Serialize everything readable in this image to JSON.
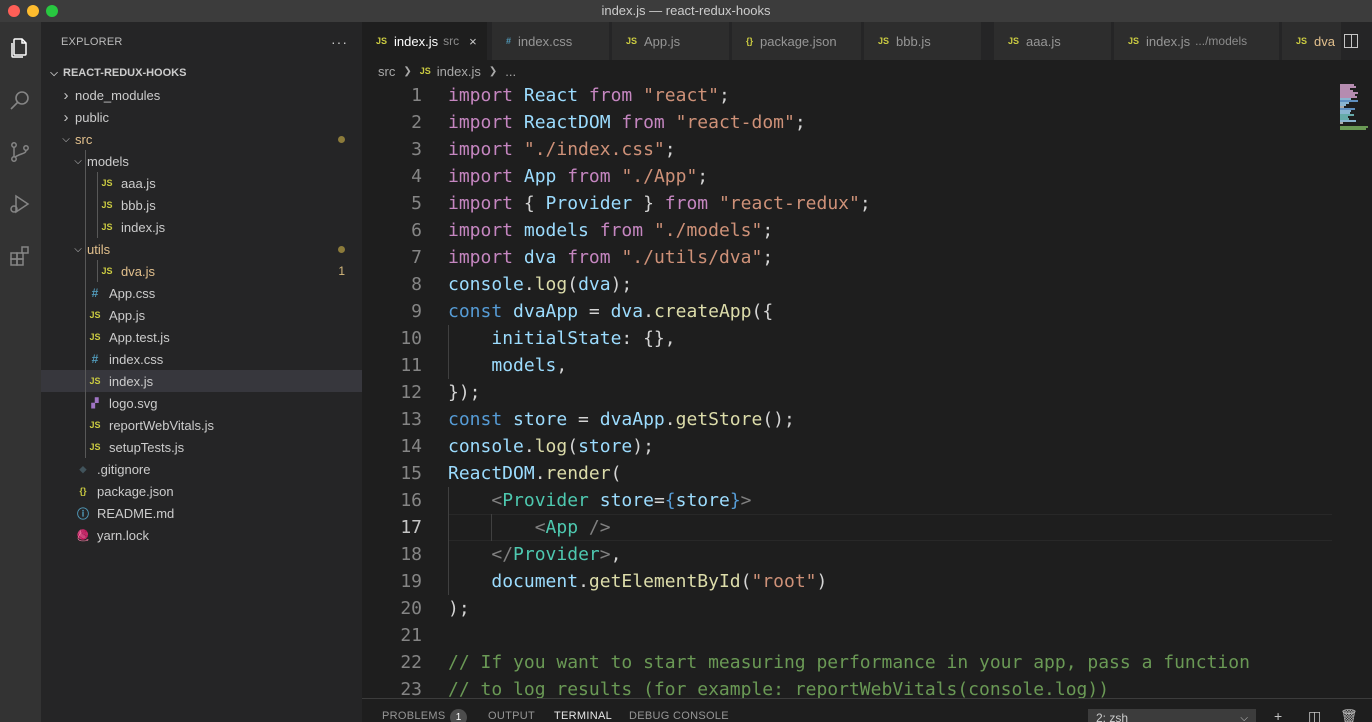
{
  "window": {
    "title": "index.js — react-redux-hooks"
  },
  "activity_bar": [
    "explorer-icon",
    "search-icon",
    "source-control-icon",
    "run-debug-icon",
    "extensions-icon"
  ],
  "sidebar": {
    "title": "EXPLORER",
    "more": "···",
    "root": "REACT-REDUX-HOOKS",
    "items": [
      {
        "label": "node_modules",
        "type": "folder",
        "open": false
      },
      {
        "label": "public",
        "type": "folder",
        "open": false
      },
      {
        "label": "src",
        "type": "folder",
        "open": true
      },
      {
        "label": "models",
        "type": "folder",
        "open": true
      },
      {
        "label": "aaa.js",
        "type": "js",
        "icon_text": "JS"
      },
      {
        "label": "bbb.js",
        "type": "js",
        "icon_text": "JS"
      },
      {
        "label": "index.js",
        "type": "js",
        "icon_text": "JS"
      },
      {
        "label": "utils",
        "type": "folder",
        "open": true
      },
      {
        "label": "dva.js",
        "type": "js",
        "icon_text": "JS",
        "count": "1"
      },
      {
        "label": "App.css",
        "type": "css",
        "icon_text": "#"
      },
      {
        "label": "App.js",
        "type": "js",
        "icon_text": "JS"
      },
      {
        "label": "App.test.js",
        "type": "js",
        "icon_text": "JS"
      },
      {
        "label": "index.css",
        "type": "css",
        "icon_text": "#"
      },
      {
        "label": "index.js",
        "type": "js",
        "icon_text": "JS",
        "selected": true
      },
      {
        "label": "logo.svg",
        "type": "svg"
      },
      {
        "label": "reportWebVitals.js",
        "type": "js",
        "icon_text": "JS"
      },
      {
        "label": "setupTests.js",
        "type": "js",
        "icon_text": "JS"
      },
      {
        "label": ".gitignore",
        "type": "git"
      },
      {
        "label": "package.json",
        "type": "json",
        "icon_text": "{}"
      },
      {
        "label": "README.md",
        "type": "md"
      },
      {
        "label": "yarn.lock",
        "type": "yarn"
      }
    ]
  },
  "tabs": [
    {
      "icon": "JS",
      "label": "index.js",
      "desc": "src",
      "active": true,
      "close": "×"
    },
    {
      "icon": "#",
      "label": "index.css"
    },
    {
      "icon": "JS",
      "label": "App.js"
    },
    {
      "icon": "{}",
      "label": "package.json"
    },
    {
      "icon": "JS",
      "label": "bbb.js"
    },
    {
      "icon": "JS",
      "label": "aaa.js"
    },
    {
      "icon": "JS",
      "label": "index.js",
      "desc": ".../models"
    },
    {
      "icon": "JS",
      "label": "dva"
    }
  ],
  "breadcrumb": {
    "folder": "src",
    "file_icon": "JS",
    "file": "index.js",
    "more": "..."
  },
  "editor": {
    "current_line": 17,
    "lines": [
      [
        [
          "kw",
          "import"
        ],
        [
          "pl",
          " "
        ],
        [
          "var",
          "React"
        ],
        [
          "pl",
          " "
        ],
        [
          "kw",
          "from"
        ],
        [
          "pl",
          " "
        ],
        [
          "str",
          "\"react\""
        ],
        [
          "pl",
          ";"
        ]
      ],
      [
        [
          "kw",
          "import"
        ],
        [
          "pl",
          " "
        ],
        [
          "var",
          "ReactDOM"
        ],
        [
          "pl",
          " "
        ],
        [
          "kw",
          "from"
        ],
        [
          "pl",
          " "
        ],
        [
          "str",
          "\"react-dom\""
        ],
        [
          "pl",
          ";"
        ]
      ],
      [
        [
          "kw",
          "import"
        ],
        [
          "pl",
          " "
        ],
        [
          "str",
          "\"./index.css\""
        ],
        [
          "pl",
          ";"
        ]
      ],
      [
        [
          "kw",
          "import"
        ],
        [
          "pl",
          " "
        ],
        [
          "var",
          "App"
        ],
        [
          "pl",
          " "
        ],
        [
          "kw",
          "from"
        ],
        [
          "pl",
          " "
        ],
        [
          "str",
          "\"./App\""
        ],
        [
          "pl",
          ";"
        ]
      ],
      [
        [
          "kw",
          "import"
        ],
        [
          "pl",
          " { "
        ],
        [
          "var",
          "Provider"
        ],
        [
          "pl",
          " } "
        ],
        [
          "kw",
          "from"
        ],
        [
          "pl",
          " "
        ],
        [
          "str",
          "\"react-redux\""
        ],
        [
          "pl",
          ";"
        ]
      ],
      [
        [
          "kw",
          "import"
        ],
        [
          "pl",
          " "
        ],
        [
          "var",
          "models"
        ],
        [
          "pl",
          " "
        ],
        [
          "kw",
          "from"
        ],
        [
          "pl",
          " "
        ],
        [
          "str",
          "\"./models\""
        ],
        [
          "pl",
          ";"
        ]
      ],
      [
        [
          "kw",
          "import"
        ],
        [
          "pl",
          " "
        ],
        [
          "var",
          "dva"
        ],
        [
          "pl",
          " "
        ],
        [
          "kw",
          "from"
        ],
        [
          "pl",
          " "
        ],
        [
          "str",
          "\"./utils/dva\""
        ],
        [
          "pl",
          ";"
        ]
      ],
      [
        [
          "var",
          "console"
        ],
        [
          "pl",
          "."
        ],
        [
          "fn",
          "log"
        ],
        [
          "pl",
          "("
        ],
        [
          "var",
          "dva"
        ],
        [
          "pl",
          ");"
        ]
      ],
      [
        [
          "kw2",
          "const"
        ],
        [
          "pl",
          " "
        ],
        [
          "var",
          "dvaApp"
        ],
        [
          "pl",
          " = "
        ],
        [
          "var",
          "dva"
        ],
        [
          "pl",
          "."
        ],
        [
          "fn",
          "createApp"
        ],
        [
          "pl",
          "({"
        ]
      ],
      [
        [
          "pl",
          "    "
        ],
        [
          "var",
          "initialState"
        ],
        [
          "pl",
          ": {},"
        ]
      ],
      [
        [
          "pl",
          "    "
        ],
        [
          "var",
          "models"
        ],
        [
          "pl",
          ","
        ]
      ],
      [
        [
          "pl",
          "});"
        ]
      ],
      [
        [
          "kw2",
          "const"
        ],
        [
          "pl",
          " "
        ],
        [
          "var",
          "store"
        ],
        [
          "pl",
          " = "
        ],
        [
          "var",
          "dvaApp"
        ],
        [
          "pl",
          "."
        ],
        [
          "fn",
          "getStore"
        ],
        [
          "pl",
          "();"
        ]
      ],
      [
        [
          "var",
          "console"
        ],
        [
          "pl",
          "."
        ],
        [
          "fn",
          "log"
        ],
        [
          "pl",
          "("
        ],
        [
          "var",
          "store"
        ],
        [
          "pl",
          ");"
        ]
      ],
      [
        [
          "var",
          "ReactDOM"
        ],
        [
          "pl",
          "."
        ],
        [
          "fn",
          "render"
        ],
        [
          "pl",
          "("
        ]
      ],
      [
        [
          "pl",
          "    "
        ],
        [
          "tag",
          "<"
        ],
        [
          "cls",
          "Provider"
        ],
        [
          "pl",
          " "
        ],
        [
          "var",
          "store"
        ],
        [
          "pl",
          "="
        ],
        [
          "bq",
          "{"
        ],
        [
          "var",
          "store"
        ],
        [
          "bq",
          "}"
        ],
        [
          "tag",
          ">"
        ]
      ],
      [
        [
          "pl",
          "        "
        ],
        [
          "tag",
          "<"
        ],
        [
          "cls",
          "App"
        ],
        [
          "pl",
          " "
        ],
        [
          "tag",
          "/>"
        ]
      ],
      [
        [
          "pl",
          "    "
        ],
        [
          "tag",
          "</"
        ],
        [
          "cls",
          "Provider"
        ],
        [
          "tag",
          ">"
        ],
        [
          "pl",
          ","
        ]
      ],
      [
        [
          "pl",
          "    "
        ],
        [
          "var",
          "document"
        ],
        [
          "pl",
          "."
        ],
        [
          "fn",
          "getElementById"
        ],
        [
          "pl",
          "("
        ],
        [
          "str",
          "\"root\""
        ],
        [
          "pl",
          ")"
        ]
      ],
      [
        [
          "pl",
          ");"
        ]
      ],
      [],
      [
        [
          "cm",
          "// If you want to start measuring performance in your app, pass a function"
        ]
      ],
      [
        [
          "cm",
          "// to log results (for example: reportWebVitals(console.log))"
        ]
      ]
    ]
  },
  "panel": {
    "tabs": [
      "PROBLEMS",
      "OUTPUT",
      "TERMINAL",
      "DEBUG CONSOLE"
    ],
    "active": "TERMINAL",
    "problems_count": "1",
    "terminal_select": "2: zsh"
  }
}
